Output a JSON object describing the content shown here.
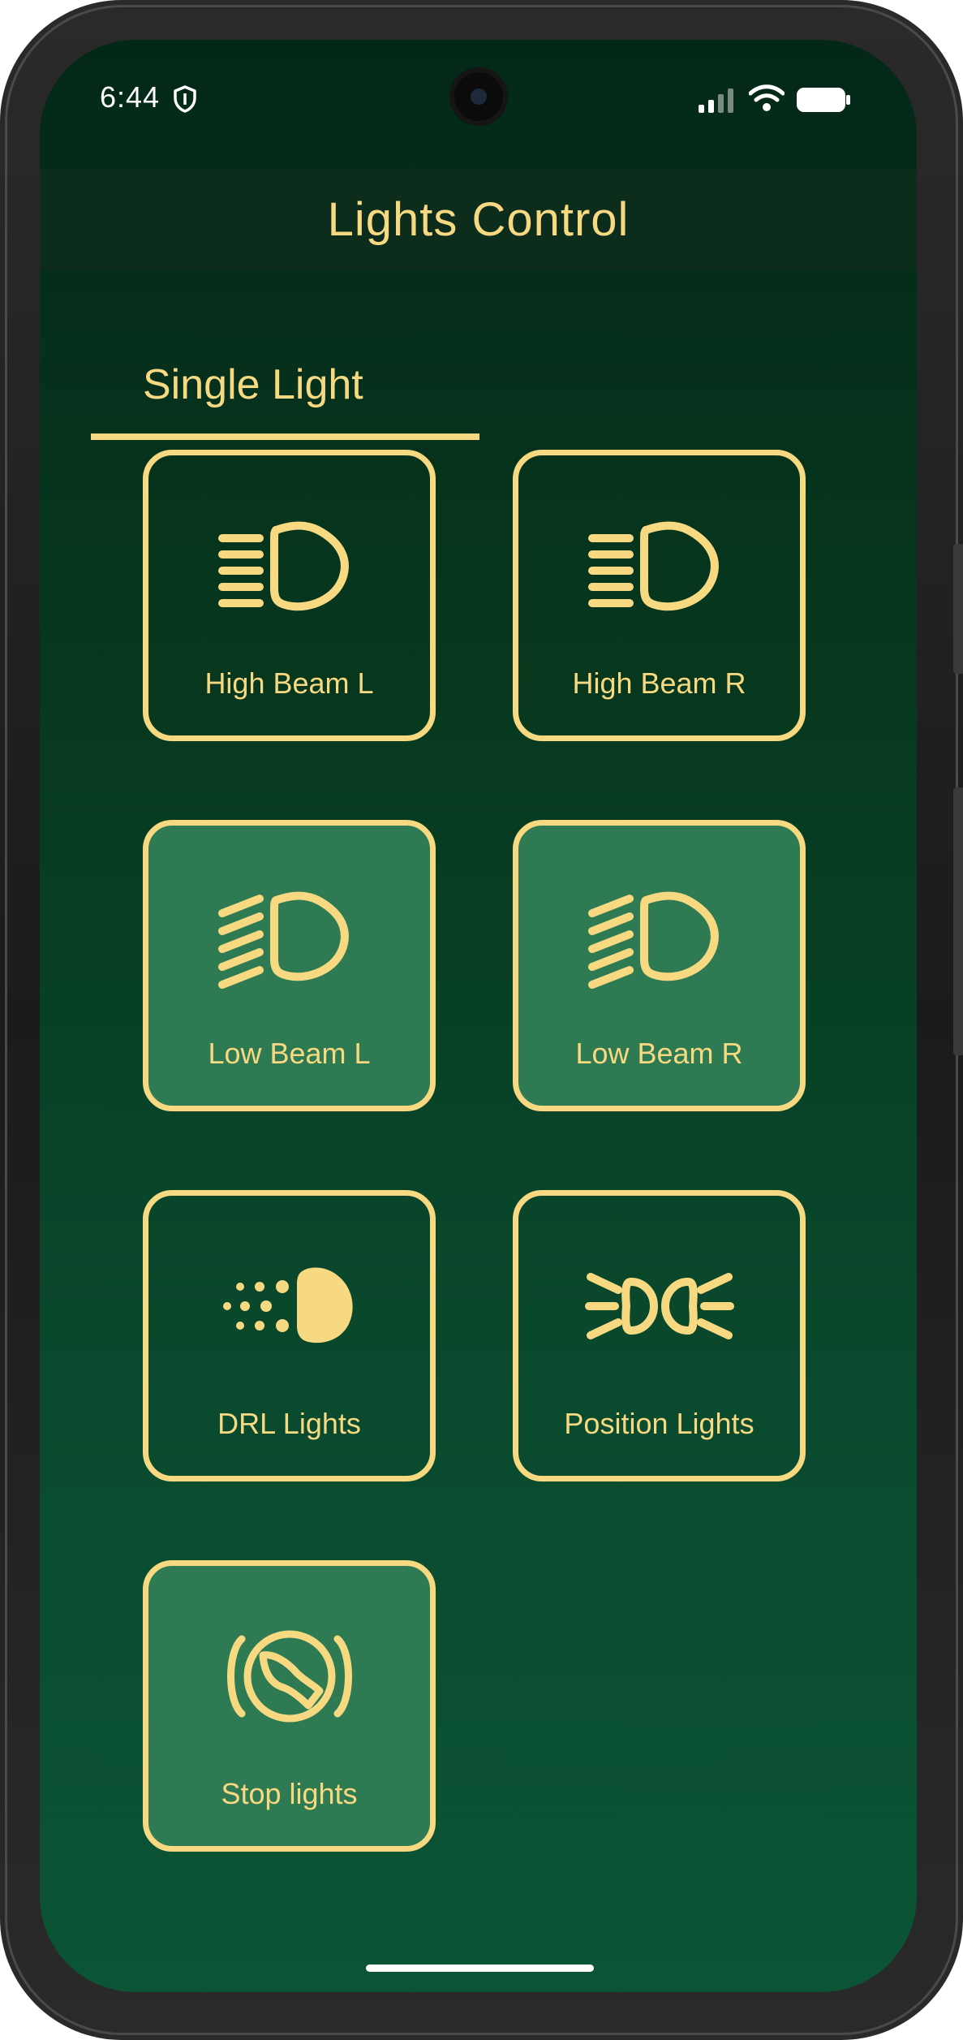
{
  "status_bar": {
    "time": "6:44",
    "icons": [
      "shield-icon",
      "signal-icon",
      "wifi-icon",
      "battery-icon"
    ]
  },
  "app_bar": {
    "title": "Lights Control"
  },
  "tabs": [
    {
      "label": "Single Light",
      "selected": true
    }
  ],
  "tiles": [
    {
      "label": "High Beam L",
      "icon": "high-beam-icon",
      "active": false
    },
    {
      "label": "High Beam R",
      "icon": "high-beam-icon",
      "active": false
    },
    {
      "label": "Low Beam L",
      "icon": "low-beam-icon",
      "active": true
    },
    {
      "label": "Low Beam R",
      "icon": "low-beam-icon",
      "active": true
    },
    {
      "label": "DRL Lights",
      "icon": "drl-icon",
      "active": false
    },
    {
      "label": "Position Lights",
      "icon": "position-lights-icon",
      "active": false
    },
    {
      "label": "Stop lights",
      "icon": "stop-lights-icon",
      "active": true
    }
  ],
  "colors": {
    "accent": "#f7d982",
    "tile_active_bg": "#2e7a53",
    "app_bar_bg": "#0c2d1c",
    "screen_bg_top": "#042818",
    "screen_bg_bottom": "#0b5436"
  }
}
